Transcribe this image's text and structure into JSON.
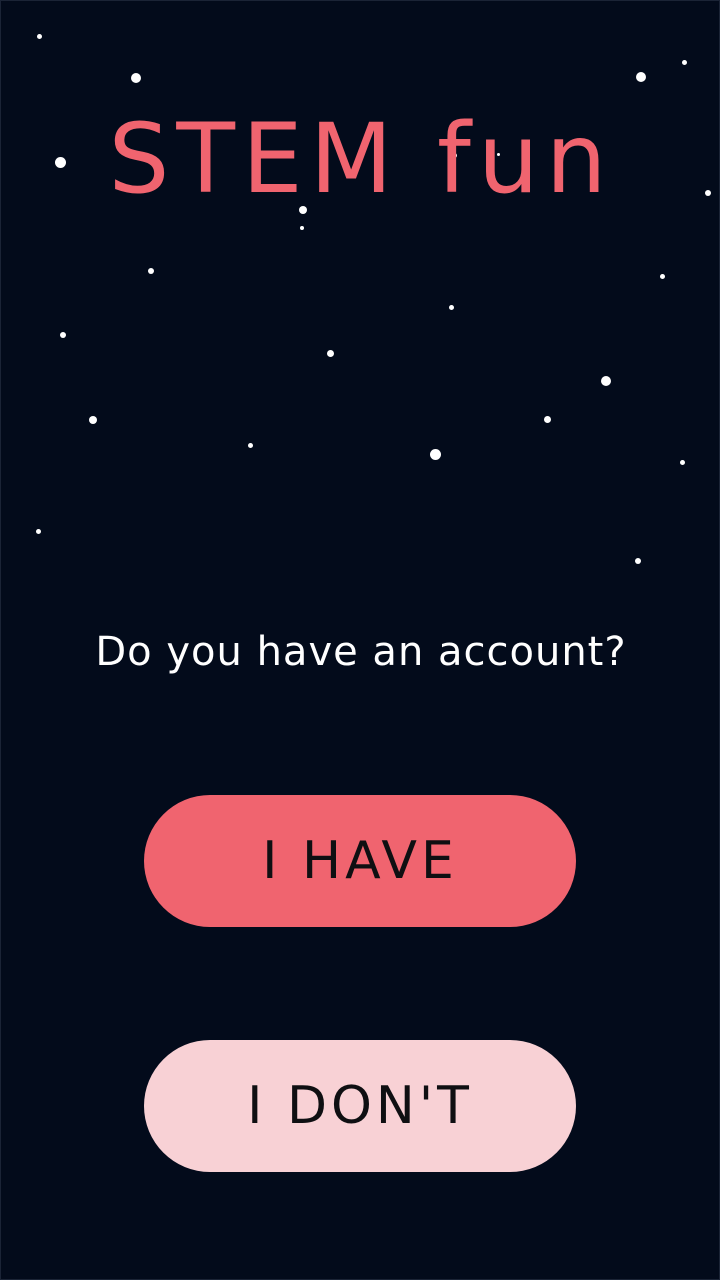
{
  "app": {
    "title": "STEM fun"
  },
  "prompt": {
    "question": "Do you have an account?"
  },
  "buttons": {
    "have_label": "I HAVE",
    "dont_label": "I DON'T"
  },
  "colors": {
    "background": "#030b1b",
    "accent": "#f0646f",
    "secondary": "#f8d1d5",
    "text_light": "#ffffff",
    "text_dark": "#0f0f12"
  }
}
